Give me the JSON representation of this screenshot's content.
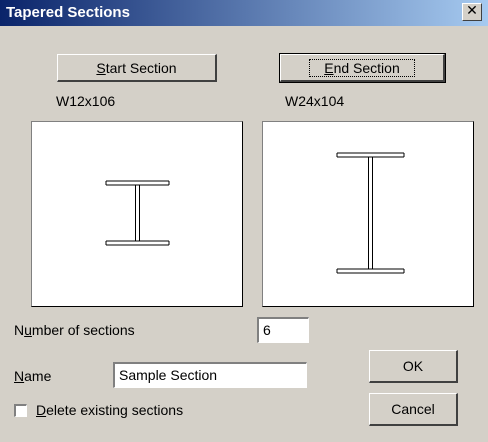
{
  "window": {
    "title": "Tapered Sections",
    "close_glyph": "✕"
  },
  "buttons": {
    "start_section": {
      "prefix": "",
      "accel": "S",
      "rest": "tart Section"
    },
    "end_section": {
      "prefix": "",
      "accel": "E",
      "rest": "nd Section"
    },
    "ok": "OK",
    "cancel": "Cancel"
  },
  "sections": {
    "start": {
      "name": "W12x106"
    },
    "end": {
      "name": "W24x104"
    }
  },
  "fields": {
    "number_of_sections": {
      "label_prefix": "N",
      "label_accel": "u",
      "label_rest": "mber of sections",
      "value": "6"
    },
    "name": {
      "label_prefix": "",
      "label_accel": "N",
      "label_rest": "ame",
      "value": "Sample Section"
    }
  },
  "options": {
    "delete_existing": {
      "label_accel": "D",
      "label_rest": "elete existing sections",
      "checked": false
    }
  },
  "icons": [
    "close-icon",
    "i-beam-icon"
  ]
}
